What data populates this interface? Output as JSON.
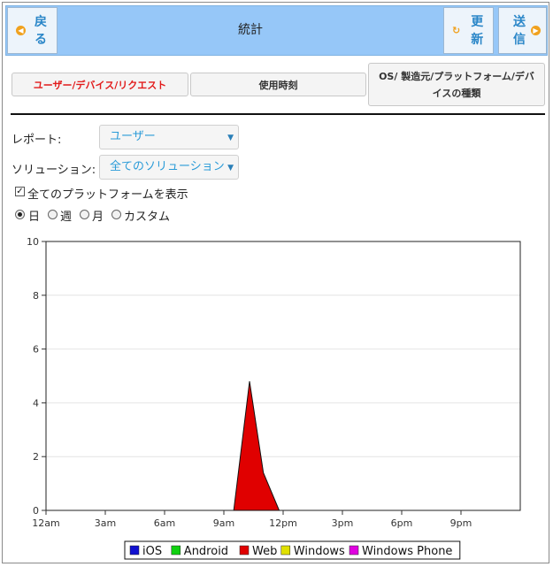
{
  "header": {
    "back_label": "戻る",
    "title": "統計",
    "refresh_label": "更新",
    "send_label": "送信"
  },
  "tabs": [
    {
      "label": "ユーザー/デバイス/リクエスト",
      "active": true
    },
    {
      "label": "使用時刻",
      "active": false
    },
    {
      "label": "OS/ 製造元/プラットフォーム/デバイスの種類",
      "active": false
    }
  ],
  "form": {
    "report_label": "レポート:",
    "report_value": "ユーザー",
    "solution_label": "ソリューション:",
    "solution_value": "全てのソリューション",
    "show_all_platforms_label": "全てのプラットフォームを表示",
    "show_all_platforms_checked": true,
    "period_options": [
      {
        "label": "日",
        "selected": true
      },
      {
        "label": "週",
        "selected": false
      },
      {
        "label": "月",
        "selected": false
      },
      {
        "label": "カスタム",
        "selected": false
      }
    ]
  },
  "chart_data": {
    "type": "area",
    "x_tick_labels": [
      "12am",
      "3am",
      "6am",
      "9am",
      "12pm",
      "3pm",
      "6pm",
      "9pm"
    ],
    "x_unit": "hour",
    "xlim": [
      0,
      24
    ],
    "ylim": [
      0,
      10
    ],
    "y_ticks": [
      0,
      2,
      4,
      6,
      8,
      10
    ],
    "grid": true,
    "legend_position": "bottom",
    "series": [
      {
        "name": "iOS",
        "color": "#1010d0",
        "x": [],
        "y": []
      },
      {
        "name": "Android",
        "color": "#10d010",
        "x": [],
        "y": []
      },
      {
        "name": "Web",
        "color": "#e00000",
        "x": [
          9.5,
          10.3,
          11.0,
          11.8
        ],
        "y": [
          0,
          4.8,
          1.4,
          0
        ]
      },
      {
        "name": "Windows",
        "color": "#e0e000",
        "x": [],
        "y": []
      },
      {
        "name": "Windows Phone",
        "color": "#e000e0",
        "x": [],
        "y": []
      }
    ]
  }
}
